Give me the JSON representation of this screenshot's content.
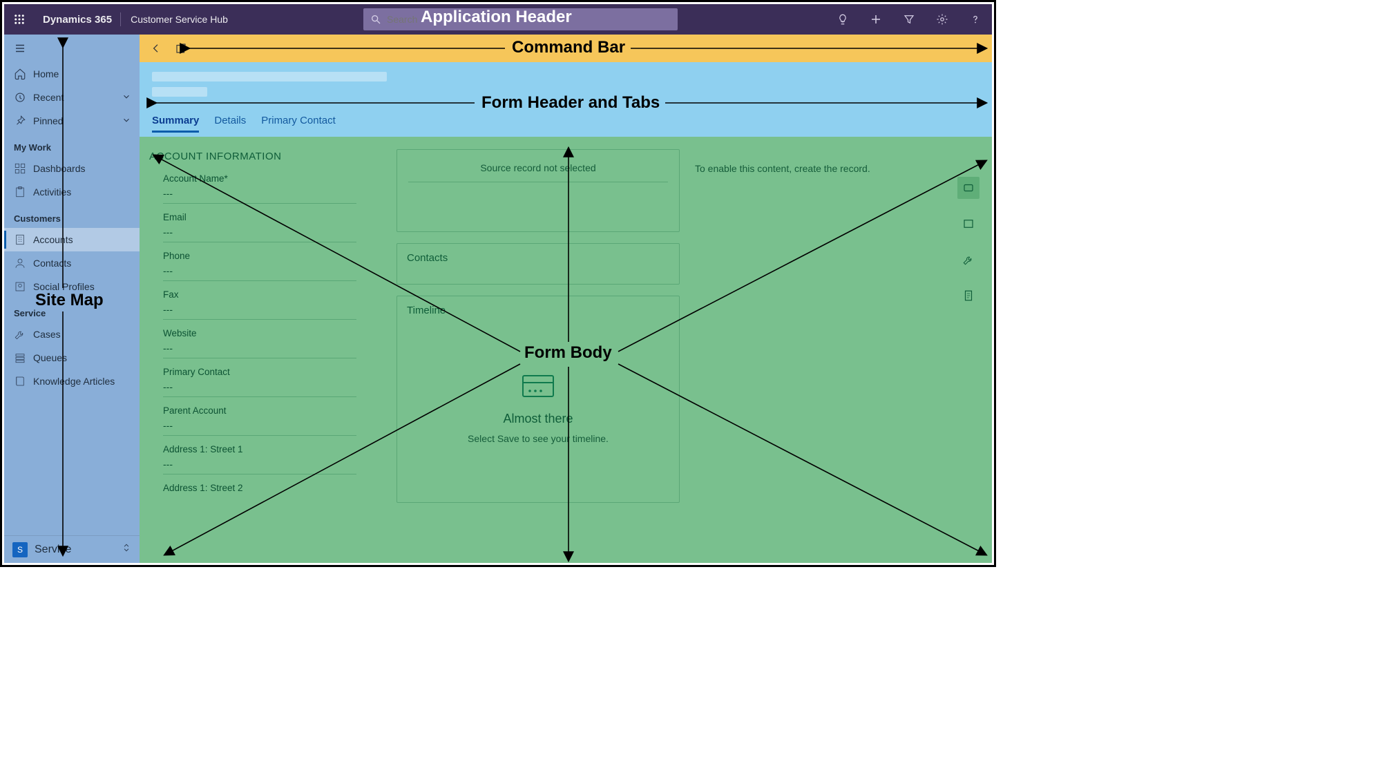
{
  "header": {
    "brand": "Dynamics 365",
    "app_name": "Customer Service Hub",
    "search_placeholder": "Search"
  },
  "annotations": {
    "app_header": "Application Header",
    "command_bar": "Command Bar",
    "form_header": "Form Header and Tabs",
    "site_map": "Site Map",
    "form_body": "Form Body"
  },
  "sitemap": {
    "top": [
      {
        "label": "Home"
      },
      {
        "label": "Recent"
      },
      {
        "label": "Pinned"
      }
    ],
    "sections": [
      {
        "title": "My Work",
        "items": [
          {
            "label": "Dashboards"
          },
          {
            "label": "Activities"
          }
        ]
      },
      {
        "title": "Customers",
        "items": [
          {
            "label": "Accounts",
            "selected": true
          },
          {
            "label": "Contacts"
          },
          {
            "label": "Social Profiles"
          }
        ]
      },
      {
        "title": "Service",
        "items": [
          {
            "label": "Cases"
          },
          {
            "label": "Queues"
          },
          {
            "label": "Knowledge Articles"
          }
        ]
      }
    ],
    "area_badge": "S",
    "area_label": "Service"
  },
  "tabs": [
    {
      "label": "Summary",
      "active": true
    },
    {
      "label": "Details"
    },
    {
      "label": "Primary Contact"
    }
  ],
  "form": {
    "account_info_title": "ACCOUNT INFORMATION",
    "empty_value": "---",
    "fields": [
      {
        "label": "Account Name",
        "required": true
      },
      {
        "label": "Email"
      },
      {
        "label": "Phone"
      },
      {
        "label": "Fax"
      },
      {
        "label": "Website"
      },
      {
        "label": "Primary Contact"
      },
      {
        "label": "Parent Account"
      },
      {
        "label": "Address 1: Street 1"
      },
      {
        "label": "Address 1: Street 2"
      }
    ],
    "source_hint": "Source record not selected",
    "contacts_title": "Contacts",
    "timeline_title": "Timeline",
    "timeline_heading": "Almost there",
    "timeline_sub": "Select Save to see your timeline.",
    "enable_msg": "To enable this content, create the record."
  }
}
